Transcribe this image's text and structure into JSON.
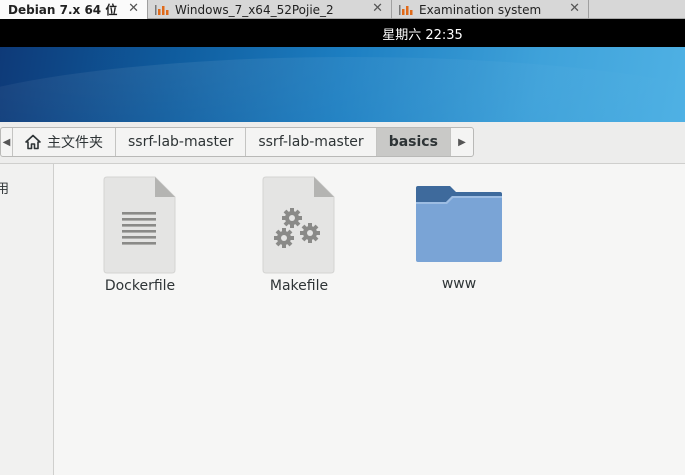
{
  "host_tabs": [
    {
      "label": "Debian 7.x 64 位",
      "active": true
    },
    {
      "label": "Windows_7_x64_52Pojie_2",
      "active": false
    },
    {
      "label": "Examination system",
      "active": false
    }
  ],
  "topbar": {
    "clock": "星期六 22:35"
  },
  "pathbar": {
    "home": "主文件夹",
    "crumbs": [
      "ssrf-lab-master",
      "ssrf-lab-master",
      "basics"
    ]
  },
  "sidebar": {
    "partial_label": "用"
  },
  "files": [
    {
      "name": "Dockerfile",
      "icon": "text-file-icon"
    },
    {
      "name": "Makefile",
      "icon": "makefile-icon"
    },
    {
      "name": "www",
      "icon": "folder-icon"
    }
  ],
  "colors": {
    "folder": "#6d9bd1",
    "wallpaper": "#1d7fc2",
    "selected_crumb": "#c9c9c7"
  }
}
